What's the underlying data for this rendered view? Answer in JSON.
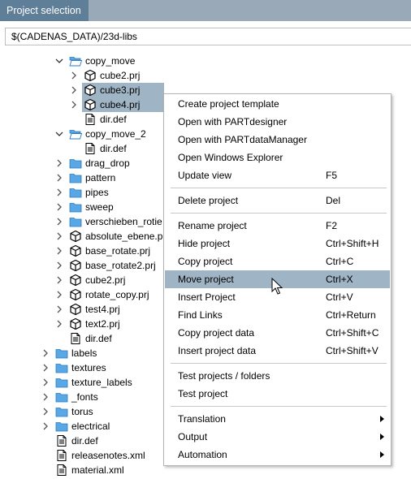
{
  "tab": {
    "label": "Project selection"
  },
  "path": {
    "value": "$(CADENAS_DATA)/23d-libs"
  },
  "tree": [
    {
      "label": "copy_move",
      "icon": "folder-open",
      "expander": "expanded",
      "indent": 4
    },
    {
      "label": "cube2.prj",
      "icon": "cube",
      "expander": "collapsed",
      "indent": 5
    },
    {
      "label": "cube3.prj",
      "icon": "cube",
      "expander": "collapsed",
      "indent": 5,
      "selected": true
    },
    {
      "label": "cube4.prj",
      "icon": "cube",
      "expander": "collapsed",
      "indent": 5,
      "selected": true
    },
    {
      "label": "dir.def",
      "icon": "file",
      "expander": "none",
      "indent": 5
    },
    {
      "label": "copy_move_2",
      "icon": "folder-open",
      "expander": "expanded",
      "indent": 4
    },
    {
      "label": "dir.def",
      "icon": "file",
      "expander": "none",
      "indent": 5
    },
    {
      "label": "drag_drop",
      "icon": "folder",
      "expander": "collapsed",
      "indent": 4
    },
    {
      "label": "pattern",
      "icon": "folder",
      "expander": "collapsed",
      "indent": 4
    },
    {
      "label": "pipes",
      "icon": "folder",
      "expander": "collapsed",
      "indent": 4
    },
    {
      "label": "sweep",
      "icon": "folder",
      "expander": "collapsed",
      "indent": 4
    },
    {
      "label": "verschieben_rotie",
      "icon": "folder",
      "expander": "collapsed",
      "indent": 4
    },
    {
      "label": "absolute_ebene.p",
      "icon": "cube",
      "expander": "collapsed",
      "indent": 4
    },
    {
      "label": "base_rotate.prj",
      "icon": "cube",
      "expander": "collapsed",
      "indent": 4
    },
    {
      "label": "base_rotate2.prj",
      "icon": "cube",
      "expander": "collapsed",
      "indent": 4
    },
    {
      "label": "cube2.prj",
      "icon": "cube",
      "expander": "collapsed",
      "indent": 4
    },
    {
      "label": "rotate_copy.prj",
      "icon": "cube",
      "expander": "collapsed",
      "indent": 4
    },
    {
      "label": "test4.prj",
      "icon": "cube",
      "expander": "collapsed",
      "indent": 4
    },
    {
      "label": "text2.prj",
      "icon": "cube",
      "expander": "collapsed",
      "indent": 4
    },
    {
      "label": "dir.def",
      "icon": "file",
      "expander": "none",
      "indent": 4
    },
    {
      "label": "labels",
      "icon": "folder",
      "expander": "collapsed",
      "indent": 3
    },
    {
      "label": "textures",
      "icon": "folder",
      "expander": "collapsed",
      "indent": 3
    },
    {
      "label": "texture_labels",
      "icon": "folder",
      "expander": "collapsed",
      "indent": 3
    },
    {
      "label": "_fonts",
      "icon": "folder",
      "expander": "collapsed",
      "indent": 3
    },
    {
      "label": "torus",
      "icon": "folder",
      "expander": "collapsed",
      "indent": 3
    },
    {
      "label": "electrical",
      "icon": "folder",
      "expander": "collapsed",
      "indent": 3
    },
    {
      "label": "dir.def",
      "icon": "file",
      "expander": "none",
      "indent": 3
    },
    {
      "label": "releasenotes.xml",
      "icon": "file",
      "expander": "none",
      "indent": 3
    },
    {
      "label": "material.xml",
      "icon": "file",
      "expander": "none",
      "indent": 3
    }
  ],
  "menu": {
    "groups": [
      [
        {
          "label": "Create project template",
          "shortcut": ""
        },
        {
          "label": "Open with PARTdesigner",
          "shortcut": ""
        },
        {
          "label": "Open with PARTdataManager",
          "shortcut": ""
        },
        {
          "label": "Open Windows Explorer",
          "shortcut": ""
        },
        {
          "label": "Update view",
          "shortcut": "F5"
        }
      ],
      [
        {
          "label": "Delete project",
          "shortcut": "Del"
        }
      ],
      [
        {
          "label": "Rename project",
          "shortcut": "F2"
        },
        {
          "label": "Hide project",
          "shortcut": "Ctrl+Shift+H"
        },
        {
          "label": "Copy project",
          "shortcut": "Ctrl+C"
        },
        {
          "label": "Move project",
          "shortcut": "Ctrl+X",
          "highlighted": true
        },
        {
          "label": "Insert Project",
          "shortcut": "Ctrl+V"
        },
        {
          "label": "Find Links",
          "shortcut": "Ctrl+Return"
        },
        {
          "label": "Copy project data",
          "shortcut": "Ctrl+Shift+C"
        },
        {
          "label": "Insert project data",
          "shortcut": "Ctrl+Shift+V"
        }
      ],
      [
        {
          "label": "Test projects / folders",
          "shortcut": ""
        },
        {
          "label": "Test project",
          "shortcut": ""
        }
      ],
      [
        {
          "label": "Translation",
          "shortcut": "",
          "submenu": true
        },
        {
          "label": "Output",
          "shortcut": "",
          "submenu": true
        },
        {
          "label": "Automation",
          "shortcut": "",
          "submenu": true
        }
      ]
    ]
  },
  "colors": {
    "tab_bg": "#5f7f99",
    "tabbar_bg": "#9aa9b7",
    "selection": "#9fb4c4",
    "folder": "#5aa7e6"
  }
}
